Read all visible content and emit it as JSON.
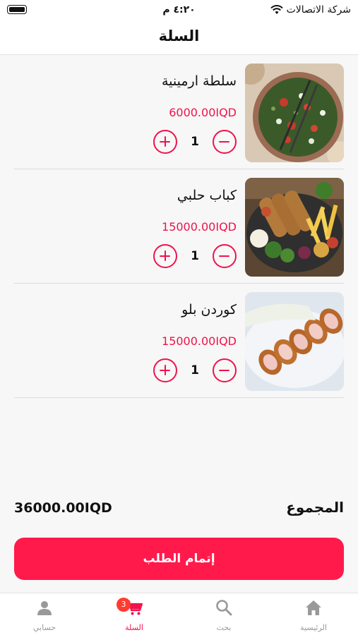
{
  "status_bar": {
    "carrier": "شركة الاتصالات",
    "time": "٤:٢٠ م"
  },
  "header": {
    "title": "السلة"
  },
  "cart": {
    "items": [
      {
        "name": "سلطة ارمينية",
        "price": "6000.00IQD",
        "quantity": "1",
        "image": "armenian-salad-photo"
      },
      {
        "name": "كباب حلبي",
        "price": "15000.00IQD",
        "quantity": "1",
        "image": "aleppo-kebab-photo"
      },
      {
        "name": "كوردن بلو",
        "price": "15000.00IQD",
        "quantity": "1",
        "image": "cordon-bleu-photo"
      }
    ]
  },
  "total": {
    "label": "المجموع",
    "value": "36000.00IQD"
  },
  "checkout": {
    "label": "إتمام الطلب"
  },
  "tab_bar": {
    "tabs": [
      {
        "label": "الرئيسية",
        "icon": "home-icon"
      },
      {
        "label": "بحث",
        "icon": "search-icon"
      },
      {
        "label": "السلة",
        "icon": "cart-icon",
        "badge": "3",
        "active": true
      },
      {
        "label": "حسابي",
        "icon": "user-icon"
      }
    ]
  },
  "colors": {
    "accent": "#f0124b",
    "checkout_button": "#ff1a4b",
    "badge": "#ff3b30",
    "inactive_tab": "#999999"
  }
}
